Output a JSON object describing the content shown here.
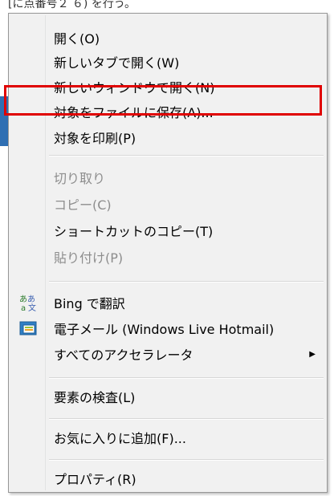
{
  "background": {
    "top_text": "[に点番号２ ６)  を行う。"
  },
  "menu": {
    "items": [
      {
        "label": "開く(O)",
        "disabled": false
      },
      {
        "label": "新しいタブで開く(W)",
        "disabled": false
      },
      {
        "label": "新しいウィンドウで開く(N)",
        "disabled": false
      },
      {
        "label": "対象をファイルに保存(A)...",
        "disabled": false,
        "highlighted": true
      },
      {
        "label": "対象を印刷(P)",
        "disabled": false
      },
      {
        "label": "切り取り",
        "disabled": true
      },
      {
        "label": "コピー(C)",
        "disabled": true
      },
      {
        "label": "ショートカットのコピー(T)",
        "disabled": false
      },
      {
        "label": "貼り付け(P)",
        "disabled": true
      },
      {
        "label": "Bing で翻訳",
        "disabled": false,
        "icon": "translate-icon"
      },
      {
        "label": "電子メール (Windows Live Hotmail)",
        "disabled": false,
        "icon": "email-icon"
      },
      {
        "label": "すべてのアクセラレータ",
        "disabled": false,
        "submenu": true
      },
      {
        "label": "要素の検査(L)",
        "disabled": false
      },
      {
        "label": "お気に入りに追加(F)...",
        "disabled": false
      },
      {
        "label": "プロパティ(R)",
        "disabled": false
      }
    ]
  },
  "colors": {
    "highlight_border": "#e00000",
    "disabled_text": "#8d8d8d",
    "menu_bg": "#f1f1f1"
  }
}
